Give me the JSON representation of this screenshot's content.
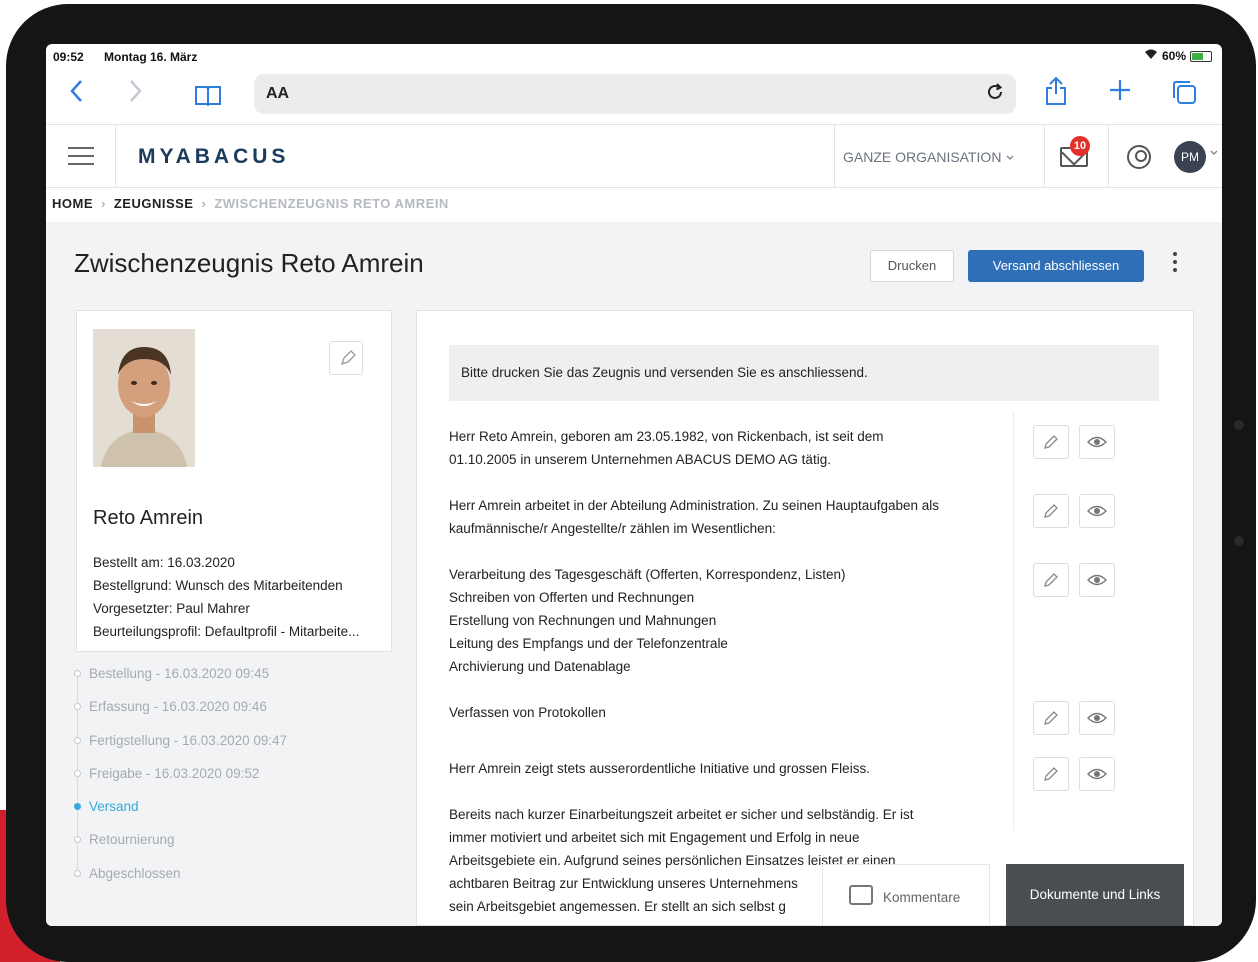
{
  "statusbar": {
    "time": "09:52",
    "date": "Montag 16. März",
    "battery": "60%"
  },
  "browser": {
    "text_size_label": "AA"
  },
  "app": {
    "logo": "MYABACUS",
    "organization_selector": "GANZE ORGANISATION",
    "notification_count": "10",
    "avatar_initials": "PM"
  },
  "breadcrumb": {
    "home": "HOME",
    "section": "ZEUGNISSE",
    "current": "ZWISCHENZEUGNIS RETO AMREIN"
  },
  "page": {
    "title": "Zwischenzeugnis Reto Amrein",
    "print_button": "Drucken",
    "finish_button": "Versand abschliessen"
  },
  "profile": {
    "name": "Reto Amrein",
    "ordered": "Bestellt am: 16.03.2020",
    "reason": "Bestellgrund: Wunsch des Mitarbeitenden",
    "supervisor": "Vorgesetzter: Paul Mahrer",
    "profile": "Beurteilungsprofil: Defaultprofil - Mitarbeite..."
  },
  "timeline": [
    {
      "label": "Bestellung - 16.03.2020 09:45",
      "active": false
    },
    {
      "label": "Erfassung - 16.03.2020 09:46",
      "active": false
    },
    {
      "label": "Fertigstellung - 16.03.2020 09:47",
      "active": false
    },
    {
      "label": "Freigabe - 16.03.2020 09:52",
      "active": false
    },
    {
      "label": "Versand",
      "active": true
    },
    {
      "label": "Retournierung",
      "active": false
    },
    {
      "label": "Abgeschlossen",
      "active": false
    }
  ],
  "document": {
    "info": "Bitte drucken Sie das Zeugnis und versenden Sie es anschliessend.",
    "p1": [
      "Herr Reto Amrein, geboren am 23.05.1982, von Rickenbach, ist seit dem",
      "01.10.2005 in unserem Unternehmen ABACUS DEMO AG tätig."
    ],
    "p2": [
      "Herr Amrein arbeitet in der Abteilung Administration. Zu seinen Hauptaufgaben als",
      "kaufmännische/r Angestellte/r zählen im Wesentlichen:"
    ],
    "p3": [
      "Verarbeitung des Tagesgeschäft (Offerten, Korrespondenz, Listen)",
      "Schreiben von Offerten und Rechnungen",
      "Erstellung von Rechnungen und Mahnungen",
      "Leitung des Empfangs und der Telefonzentrale",
      "Archivierung und Datenablage"
    ],
    "p4": [
      "Verfassen von Protokollen"
    ],
    "p5": [
      "Herr Amrein zeigt stets ausserordentliche Initiative und grossen Fleiss."
    ],
    "p6": [
      "Bereits nach kurzer Einarbeitungszeit arbeitet  er sicher und selbständig. Er ist",
      "immer motiviert und arbeitet sich mit Engagement und Erfolg in neue",
      "Arbeitsgebiete ein. Aufgrund seines persönlichen Einsatzes leistet er einen",
      "achtbaren Beitrag zur Entwicklung unseres Unternehmens",
      "sein Arbeitsgebiet angemessen. Er stellt an sich selbst g"
    ]
  },
  "bottom": {
    "comments": "Kommentare",
    "documents": "Dokumente und Links"
  }
}
